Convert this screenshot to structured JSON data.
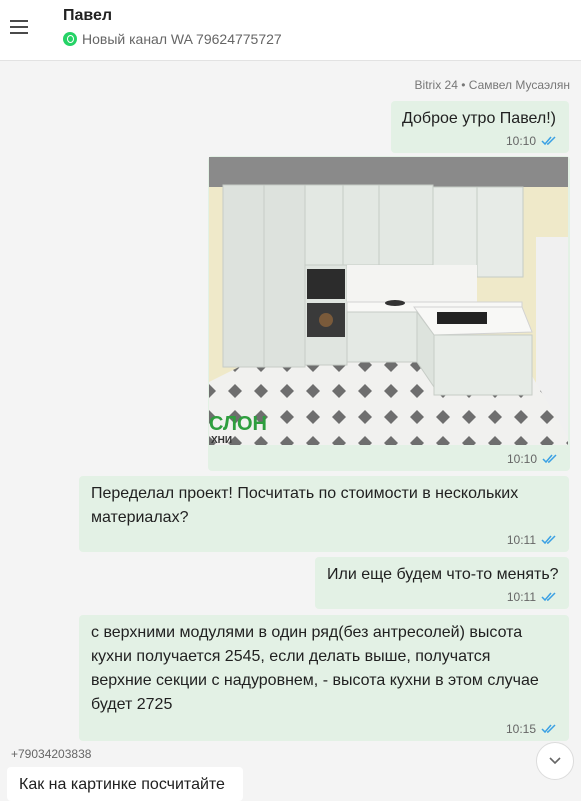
{
  "header": {
    "contact_name": "Павел",
    "channel": "Новый канал WA 79624775727"
  },
  "messages": [
    {
      "text": "Доброе утро Павел!)",
      "time": "10:10",
      "direction": "out"
    },
    {
      "type": "image",
      "time": "10:10",
      "direction": "out",
      "watermark_line1": "СЛОН",
      "watermark_line2": "ХНИ"
    },
    {
      "text": "Переделал проект! Посчитать по стоимости в нескольких материалах?",
      "time": "10:11",
      "direction": "out"
    },
    {
      "text": "Или еще будем что-то менять?",
      "time": "10:11",
      "direction": "out"
    },
    {
      "text": "с верхними модулями в один ряд(без антресолей) высота кухни получается 2545, если делать выше, получатся верхние секции с надуровнем, - высота кухни в этом случае будет 2725",
      "time": "10:15",
      "direction": "out"
    },
    {
      "text": "Как на картинке посчитайте",
      "direction": "in"
    }
  ],
  "sender_top": "Bitrix 24 • Самвел Мусаэлян",
  "sender_phone": "+79034203838",
  "colors": {
    "outgoing_bubble": "#e3f1e5",
    "check": "#3aa0e4",
    "whatsapp": "#25d366"
  }
}
